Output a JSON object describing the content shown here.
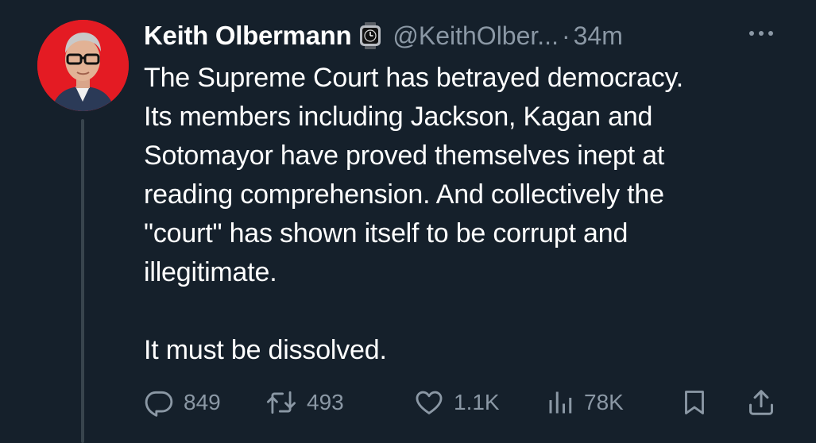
{
  "tweet": {
    "author_name": "Keith Olbermann",
    "handle": "@KeithOlber...",
    "separator": "·",
    "time": "34m",
    "text": "The Supreme Court has betrayed democracy.\nIts members including Jackson, Kagan and\nSotomayor have proved themselves inept at\nreading comprehension. And collectively the\n\"court\" has shown itself to be corrupt and\nillegitimate.\n\nIt must be dissolved."
  },
  "actions": {
    "replies": "849",
    "retweets": "493",
    "likes": "1.1K",
    "views": "78K"
  },
  "icons": {
    "verified_badge": "watch-icon",
    "more": "more-horizontal-icon",
    "reply": "reply-icon",
    "retweet": "retweet-icon",
    "like": "heart-icon",
    "views": "views-bar-chart-icon",
    "bookmark": "bookmark-icon",
    "share": "share-icon"
  },
  "colors": {
    "background": "#15202b",
    "primary_text": "#ffffff",
    "secondary_text": "#8b98a5",
    "thread_line": "#38444d",
    "avatar_background": "#e41b23"
  }
}
